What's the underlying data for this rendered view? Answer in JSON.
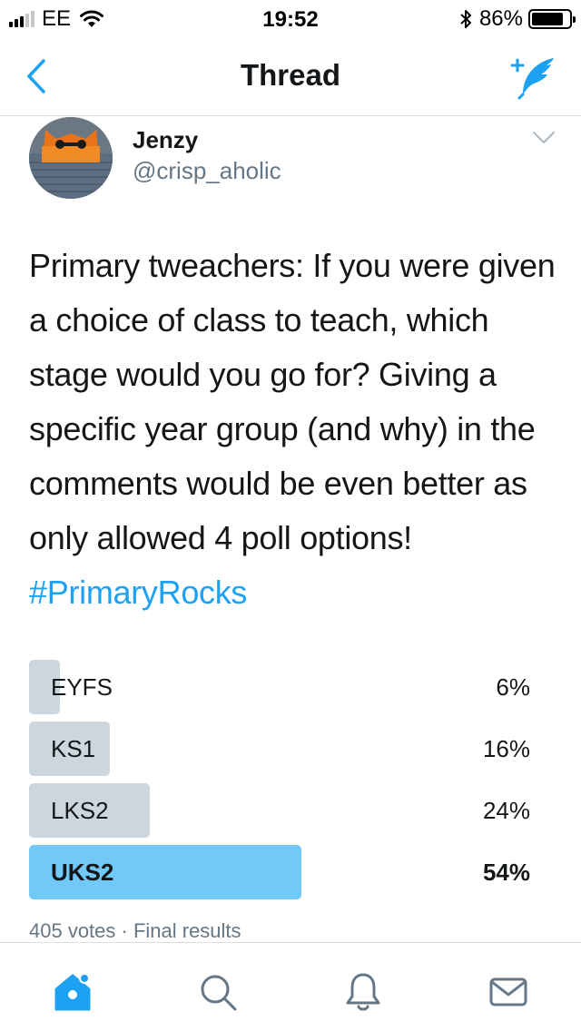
{
  "status_bar": {
    "carrier": "EE",
    "time": "19:52",
    "battery_percent": "86%",
    "battery_level": 0.86,
    "icons": [
      "signal-icon",
      "wifi-icon",
      "bluetooth-icon",
      "battery-icon"
    ]
  },
  "nav": {
    "title": "Thread",
    "back_icon": "chevron-left-icon",
    "compose_icon": "compose-tweet-icon"
  },
  "tweet": {
    "display_name": "Jenzy",
    "handle": "@crisp_aholic",
    "text": "Primary tweachers: If you were given a choice of class to teach, which stage would you go for? Giving a specific year group (and why) in the comments would be even better as only allowed 4 poll options! ",
    "hashtag": "#PrimaryRocks",
    "menu_icon": "chevron-down-icon"
  },
  "poll": {
    "options": [
      {
        "label": "EYFS",
        "percent_text": "6%",
        "percent": 6
      },
      {
        "label": "KS1",
        "percent_text": "16%",
        "percent": 16
      },
      {
        "label": "LKS2",
        "percent_text": "24%",
        "percent": 24
      },
      {
        "label": "UKS2",
        "percent_text": "54%",
        "percent": 54
      }
    ],
    "meta": "405 votes · Final results"
  },
  "tab_bar": {
    "tabs": [
      "home-icon",
      "search-icon",
      "notifications-icon",
      "messages-icon"
    ]
  },
  "colors": {
    "accent": "#1da1f2",
    "poll_winner": "#71c9f8",
    "poll_other": "#ccd6dd",
    "secondary_text": "#657786"
  }
}
